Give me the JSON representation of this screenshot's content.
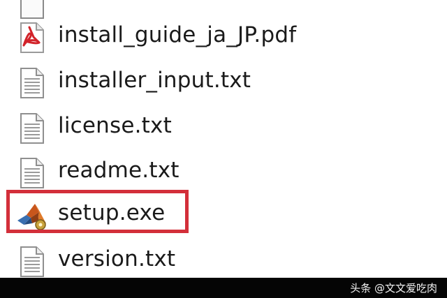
{
  "files": [
    {
      "name": "install_guide_ja_JP.pdf",
      "icon": "pdf-icon"
    },
    {
      "name": "installer_input.txt",
      "icon": "text-file-icon"
    },
    {
      "name": "license.txt",
      "icon": "text-file-icon"
    },
    {
      "name": "readme.txt",
      "icon": "text-file-icon"
    },
    {
      "name": "setup.exe",
      "icon": "matlab-installer-icon",
      "highlighted": true
    },
    {
      "name": "version.txt",
      "icon": "text-file-icon"
    }
  ],
  "highlight": {
    "color": "#d32f3a"
  },
  "watermark": {
    "text": "头条 @文文爱吃肉"
  }
}
